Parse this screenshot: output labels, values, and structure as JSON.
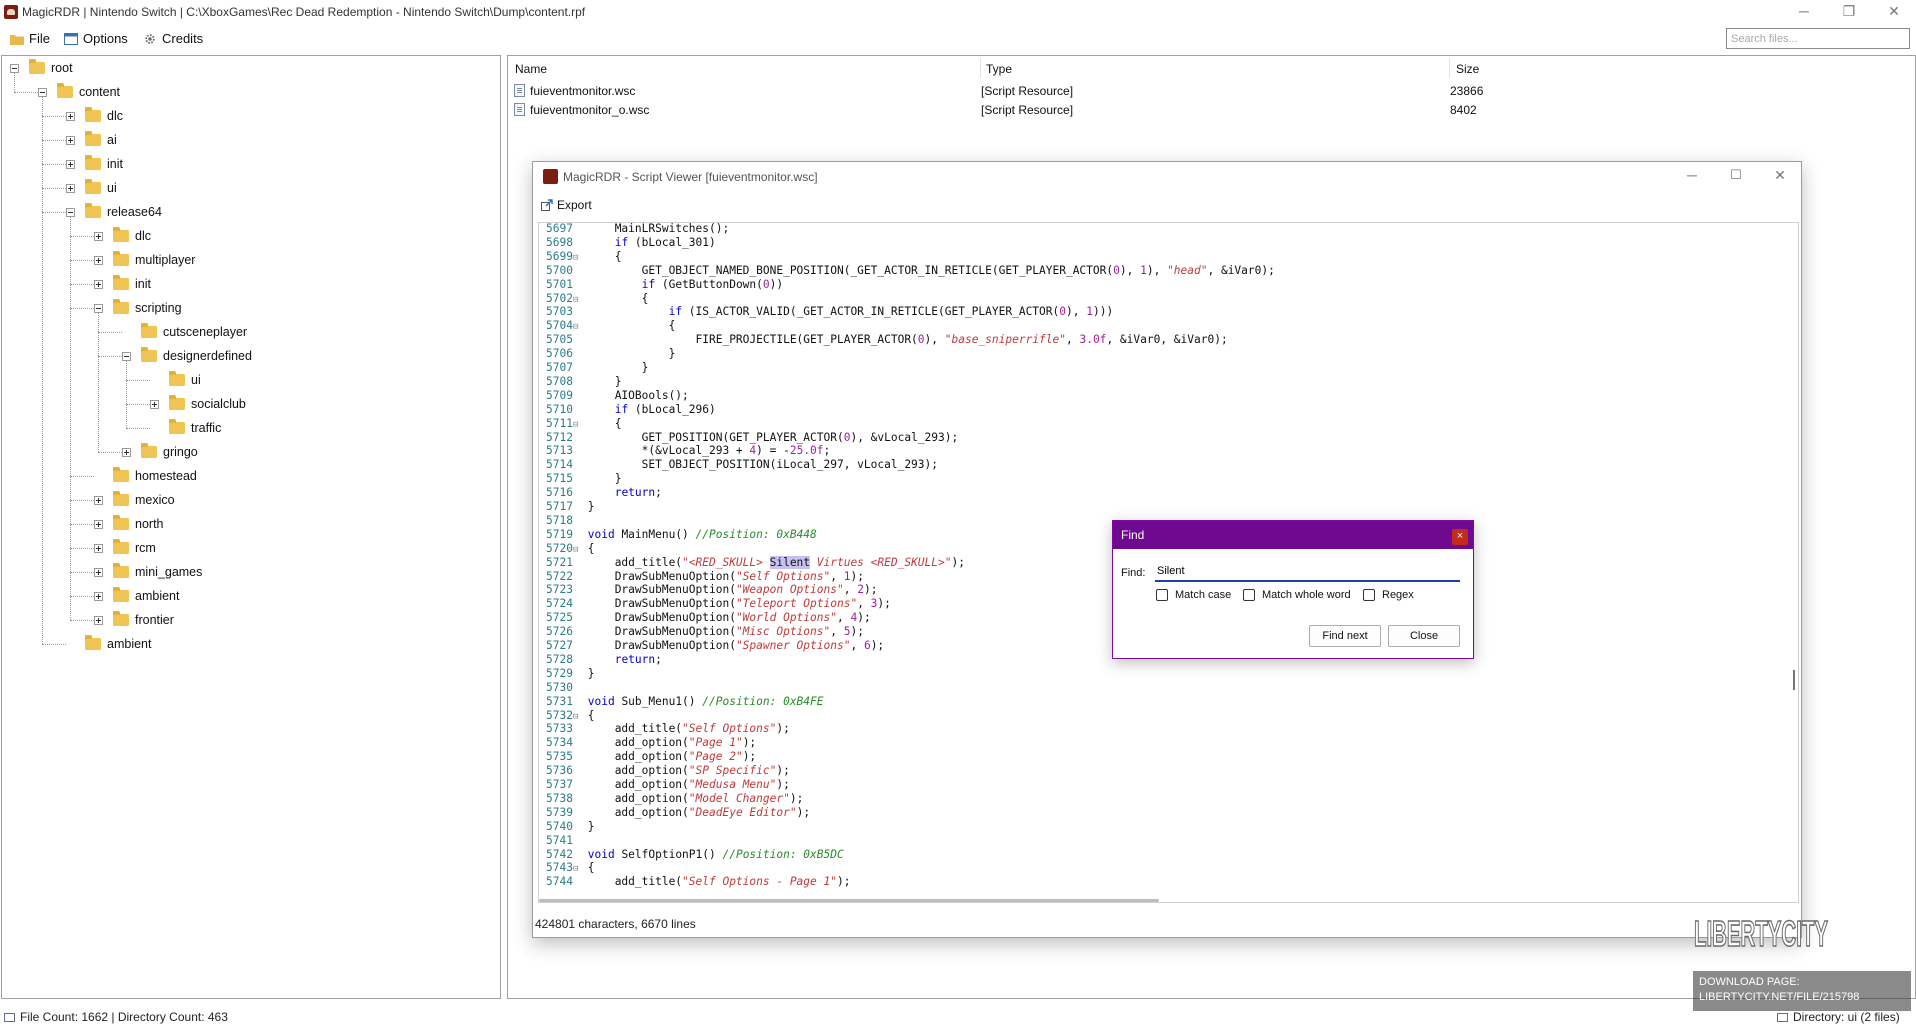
{
  "window": {
    "title": "MagicRDR | Nintendo Switch | C:\\XboxGames\\Rec Dead Redemption - Nintendo Switch\\Dump\\content.rpf",
    "minimize_glyph": "─",
    "maximize_glyph": "❐",
    "close_glyph": "✕"
  },
  "menu": {
    "file_label": "File",
    "options_label": "Options",
    "credits_label": "Credits"
  },
  "search": {
    "placeholder": "Search files..."
  },
  "tree": [
    {
      "label": "root",
      "depth": 0,
      "expander": "minus"
    },
    {
      "label": "content",
      "depth": 1,
      "expander": "minus"
    },
    {
      "label": "dlc",
      "depth": 2,
      "expander": "plus"
    },
    {
      "label": "ai",
      "depth": 2,
      "expander": "plus"
    },
    {
      "label": "init",
      "depth": 2,
      "expander": "plus"
    },
    {
      "label": "ui",
      "depth": 2,
      "expander": "plus"
    },
    {
      "label": "release64",
      "depth": 2,
      "expander": "minus"
    },
    {
      "label": "dlc",
      "depth": 3,
      "expander": "plus"
    },
    {
      "label": "multiplayer",
      "depth": 3,
      "expander": "plus"
    },
    {
      "label": "init",
      "depth": 3,
      "expander": "plus"
    },
    {
      "label": "scripting",
      "depth": 3,
      "expander": "minus"
    },
    {
      "label": "cutsceneplayer",
      "depth": 4,
      "expander": "none"
    },
    {
      "label": "designerdefined",
      "depth": 4,
      "expander": "minus"
    },
    {
      "label": "ui",
      "depth": 5,
      "expander": "none"
    },
    {
      "label": "socialclub",
      "depth": 5,
      "expander": "plus"
    },
    {
      "label": "traffic",
      "depth": 5,
      "expander": "none"
    },
    {
      "label": "gringo",
      "depth": 4,
      "expander": "plus"
    },
    {
      "label": "homestead",
      "depth": 3,
      "expander": "none"
    },
    {
      "label": "mexico",
      "depth": 3,
      "expander": "plus"
    },
    {
      "label": "north",
      "depth": 3,
      "expander": "plus"
    },
    {
      "label": "rcm",
      "depth": 3,
      "expander": "plus"
    },
    {
      "label": "mini_games",
      "depth": 3,
      "expander": "plus"
    },
    {
      "label": "ambient",
      "depth": 3,
      "expander": "plus"
    },
    {
      "label": "frontier",
      "depth": 3,
      "expander": "plus"
    },
    {
      "label": "ambient",
      "depth": 2,
      "expander": "none"
    }
  ],
  "file_list": {
    "columns": [
      "Name",
      "Type",
      "Size"
    ],
    "rows": [
      {
        "name": "fuieventmonitor.wsc",
        "type": "[Script Resource]",
        "size": "23866"
      },
      {
        "name": "fuieventmonitor_o.wsc",
        "type": "[Script Resource]",
        "size": "8402"
      }
    ]
  },
  "viewer": {
    "title": "MagicRDR - Script Viewer [fuieventmonitor.wsc]",
    "export_label": "Export",
    "status": "424801 characters, 6670 lines",
    "code": [
      {
        "n": "5697",
        "f": "",
        "t": [
          [
            "tx",
            "    MainLRSwitches();"
          ]
        ]
      },
      {
        "n": "5698",
        "f": "",
        "t": [
          [
            "tx",
            "    "
          ],
          [
            "kw",
            "if"
          ],
          [
            "tx",
            " (bLocal_301)"
          ]
        ]
      },
      {
        "n": "5699",
        "f": "⊟",
        "t": [
          [
            "tx",
            "    {"
          ]
        ]
      },
      {
        "n": "5700",
        "f": "",
        "t": [
          [
            "tx",
            "        GET_OBJECT_NAMED_BONE_POSITION(_GET_ACTOR_IN_RETICLE(GET_PLAYER_ACTOR("
          ],
          [
            "num",
            "0"
          ],
          [
            "tx",
            "), "
          ],
          [
            "num",
            "1"
          ],
          [
            "tx",
            "), "
          ],
          [
            "str",
            "\"head\""
          ],
          [
            "tx",
            ", &iVar0);"
          ]
        ]
      },
      {
        "n": "5701",
        "f": "",
        "t": [
          [
            "tx",
            "        "
          ],
          [
            "kw",
            "if"
          ],
          [
            "tx",
            " (GetButtonDown("
          ],
          [
            "num",
            "0"
          ],
          [
            "tx",
            "))"
          ]
        ]
      },
      {
        "n": "5702",
        "f": "⊟",
        "t": [
          [
            "tx",
            "        {"
          ]
        ]
      },
      {
        "n": "5703",
        "f": "",
        "t": [
          [
            "tx",
            "            "
          ],
          [
            "kw",
            "if"
          ],
          [
            "tx",
            " (IS_ACTOR_VALID(_GET_ACTOR_IN_RETICLE(GET_PLAYER_ACTOR("
          ],
          [
            "num",
            "0"
          ],
          [
            "tx",
            "), "
          ],
          [
            "num",
            "1"
          ],
          [
            "tx",
            ")))"
          ]
        ]
      },
      {
        "n": "5704",
        "f": "⊟",
        "t": [
          [
            "tx",
            "            {"
          ]
        ]
      },
      {
        "n": "5705",
        "f": "",
        "t": [
          [
            "tx",
            "                FIRE_PROJECTILE(GET_PLAYER_ACTOR("
          ],
          [
            "num",
            "0"
          ],
          [
            "tx",
            "), "
          ],
          [
            "str",
            "\"base_sniperrifle\""
          ],
          [
            "tx",
            ", "
          ],
          [
            "num",
            "3.0f"
          ],
          [
            "tx",
            ", &iVar0, &iVar0);"
          ]
        ]
      },
      {
        "n": "5706",
        "f": "",
        "t": [
          [
            "tx",
            "            }"
          ]
        ]
      },
      {
        "n": "5707",
        "f": "",
        "t": [
          [
            "tx",
            "        }"
          ]
        ]
      },
      {
        "n": "5708",
        "f": "",
        "t": [
          [
            "tx",
            "    }"
          ]
        ]
      },
      {
        "n": "5709",
        "f": "",
        "t": [
          [
            "tx",
            "    AIOBools();"
          ]
        ]
      },
      {
        "n": "5710",
        "f": "",
        "t": [
          [
            "tx",
            "    "
          ],
          [
            "kw",
            "if"
          ],
          [
            "tx",
            " (bLocal_296)"
          ]
        ]
      },
      {
        "n": "5711",
        "f": "⊟",
        "t": [
          [
            "tx",
            "    {"
          ]
        ]
      },
      {
        "n": "5712",
        "f": "",
        "t": [
          [
            "tx",
            "        GET_POSITION(GET_PLAYER_ACTOR("
          ],
          [
            "num",
            "0"
          ],
          [
            "tx",
            "), &vLocal_293);"
          ]
        ]
      },
      {
        "n": "5713",
        "f": "",
        "t": [
          [
            "tx",
            "        *(&vLocal_293 + "
          ],
          [
            "num",
            "4"
          ],
          [
            "tx",
            ") = -"
          ],
          [
            "num",
            "25.0f"
          ],
          [
            "tx",
            ";"
          ]
        ]
      },
      {
        "n": "5714",
        "f": "",
        "t": [
          [
            "tx",
            "        SET_OBJECT_POSITION(iLocal_297, vLocal_293);"
          ]
        ]
      },
      {
        "n": "5715",
        "f": "",
        "t": [
          [
            "tx",
            "    }"
          ]
        ]
      },
      {
        "n": "5716",
        "f": "",
        "t": [
          [
            "tx",
            "    "
          ],
          [
            "kw",
            "return"
          ],
          [
            "tx",
            ";"
          ]
        ]
      },
      {
        "n": "5717",
        "f": "",
        "t": [
          [
            "tx",
            "}"
          ]
        ]
      },
      {
        "n": "5718",
        "f": "",
        "t": []
      },
      {
        "n": "5719",
        "f": "",
        "t": [
          [
            "kw",
            "void"
          ],
          [
            "tx",
            " MainMenu() "
          ],
          [
            "cm",
            "//Position: 0xB448"
          ]
        ]
      },
      {
        "n": "5720",
        "f": "⊟",
        "t": [
          [
            "tx",
            "{"
          ]
        ]
      },
      {
        "n": "5721",
        "f": "",
        "t": [
          [
            "tx",
            "    add_title("
          ],
          [
            "str",
            "\"<RED_SKULL> "
          ],
          [
            "hl",
            "Silent"
          ],
          [
            "str",
            " Virtues <RED_SKULL>\""
          ],
          [
            "tx",
            ");"
          ]
        ]
      },
      {
        "n": "5722",
        "f": "",
        "t": [
          [
            "tx",
            "    DrawSubMenuOption("
          ],
          [
            "str",
            "\"Self Options\""
          ],
          [
            "tx",
            ", "
          ],
          [
            "num",
            "1"
          ],
          [
            "tx",
            ");"
          ]
        ]
      },
      {
        "n": "5723",
        "f": "",
        "t": [
          [
            "tx",
            "    DrawSubMenuOption("
          ],
          [
            "str",
            "\"Weapon Options\""
          ],
          [
            "tx",
            ", "
          ],
          [
            "num",
            "2"
          ],
          [
            "tx",
            ");"
          ]
        ]
      },
      {
        "n": "5724",
        "f": "",
        "t": [
          [
            "tx",
            "    DrawSubMenuOption("
          ],
          [
            "str",
            "\"Teleport Options\""
          ],
          [
            "tx",
            ", "
          ],
          [
            "num",
            "3"
          ],
          [
            "tx",
            ");"
          ]
        ]
      },
      {
        "n": "5725",
        "f": "",
        "t": [
          [
            "tx",
            "    DrawSubMenuOption("
          ],
          [
            "str",
            "\"World Options\""
          ],
          [
            "tx",
            ", "
          ],
          [
            "num",
            "4"
          ],
          [
            "tx",
            ");"
          ]
        ]
      },
      {
        "n": "5726",
        "f": "",
        "t": [
          [
            "tx",
            "    DrawSubMenuOption("
          ],
          [
            "str",
            "\"Misc Options\""
          ],
          [
            "tx",
            ", "
          ],
          [
            "num",
            "5"
          ],
          [
            "tx",
            ");"
          ]
        ]
      },
      {
        "n": "5727",
        "f": "",
        "t": [
          [
            "tx",
            "    DrawSubMenuOption("
          ],
          [
            "str",
            "\"Spawner Options\""
          ],
          [
            "tx",
            ", "
          ],
          [
            "num",
            "6"
          ],
          [
            "tx",
            ");"
          ]
        ]
      },
      {
        "n": "5728",
        "f": "",
        "t": [
          [
            "tx",
            "    "
          ],
          [
            "kw",
            "return"
          ],
          [
            "tx",
            ";"
          ]
        ]
      },
      {
        "n": "5729",
        "f": "",
        "t": [
          [
            "tx",
            "}"
          ]
        ]
      },
      {
        "n": "5730",
        "f": "",
        "t": []
      },
      {
        "n": "5731",
        "f": "",
        "t": [
          [
            "kw",
            "void"
          ],
          [
            "tx",
            " Sub_Menu1() "
          ],
          [
            "cm",
            "//Position: 0xB4FE"
          ]
        ]
      },
      {
        "n": "5732",
        "f": "⊟",
        "t": [
          [
            "tx",
            "{"
          ]
        ]
      },
      {
        "n": "5733",
        "f": "",
        "t": [
          [
            "tx",
            "    add_title("
          ],
          [
            "str",
            "\"Self Options\""
          ],
          [
            "tx",
            ");"
          ]
        ]
      },
      {
        "n": "5734",
        "f": "",
        "t": [
          [
            "tx",
            "    add_option("
          ],
          [
            "str",
            "\"Page 1\""
          ],
          [
            "tx",
            ");"
          ]
        ]
      },
      {
        "n": "5735",
        "f": "",
        "t": [
          [
            "tx",
            "    add_option("
          ],
          [
            "str",
            "\"Page 2\""
          ],
          [
            "tx",
            ");"
          ]
        ]
      },
      {
        "n": "5736",
        "f": "",
        "t": [
          [
            "tx",
            "    add_option("
          ],
          [
            "str",
            "\"SP Specific\""
          ],
          [
            "tx",
            ");"
          ]
        ]
      },
      {
        "n": "5737",
        "f": "",
        "t": [
          [
            "tx",
            "    add_option("
          ],
          [
            "str",
            "\"Medusa Menu\""
          ],
          [
            "tx",
            ");"
          ]
        ]
      },
      {
        "n": "5738",
        "f": "",
        "t": [
          [
            "tx",
            "    add_option("
          ],
          [
            "str",
            "\"Model Changer\""
          ],
          [
            "tx",
            ");"
          ]
        ]
      },
      {
        "n": "5739",
        "f": "",
        "t": [
          [
            "tx",
            "    add_option("
          ],
          [
            "str",
            "\"DeadEye Editor\""
          ],
          [
            "tx",
            ");"
          ]
        ]
      },
      {
        "n": "5740",
        "f": "",
        "t": [
          [
            "tx",
            "}"
          ]
        ]
      },
      {
        "n": "5741",
        "f": "",
        "t": []
      },
      {
        "n": "5742",
        "f": "",
        "t": [
          [
            "kw",
            "void"
          ],
          [
            "tx",
            " SelfOptionP1() "
          ],
          [
            "cm",
            "//Position: 0xB5DC"
          ]
        ]
      },
      {
        "n": "5743",
        "f": "⊟",
        "t": [
          [
            "tx",
            "{"
          ]
        ]
      },
      {
        "n": "5744",
        "f": "",
        "t": [
          [
            "tx",
            "    add_title("
          ],
          [
            "str",
            "\"Self Options - Page 1\""
          ],
          [
            "tx",
            ");"
          ]
        ]
      }
    ]
  },
  "find_dialog": {
    "title": "Find",
    "close_glyph": "×",
    "find_label": "Find:",
    "find_value": "Silent",
    "match_case_label": "Match case",
    "match_whole_word_label": "Match whole word",
    "regex_label": "Regex",
    "find_next_label": "Find next",
    "close_label": "Close"
  },
  "statusbar": {
    "counts": "File Count: 1662 | Directory Count: 463",
    "directory": "Directory: ui (2 files)"
  },
  "watermark": {
    "logo_text": "LIBERTYCITY",
    "line1": "DOWNLOAD PAGE:",
    "line2": "LIBERTYCITY.NET/FILE/215798"
  },
  "colors": {
    "find_titlebar": "#6e0990",
    "keyword": "#0000cc",
    "string": "#c03a3a",
    "number": "#a020a0",
    "comment": "#2a8a2a",
    "line_number": "#2b7b8a",
    "highlight": "#c7c1f2"
  }
}
